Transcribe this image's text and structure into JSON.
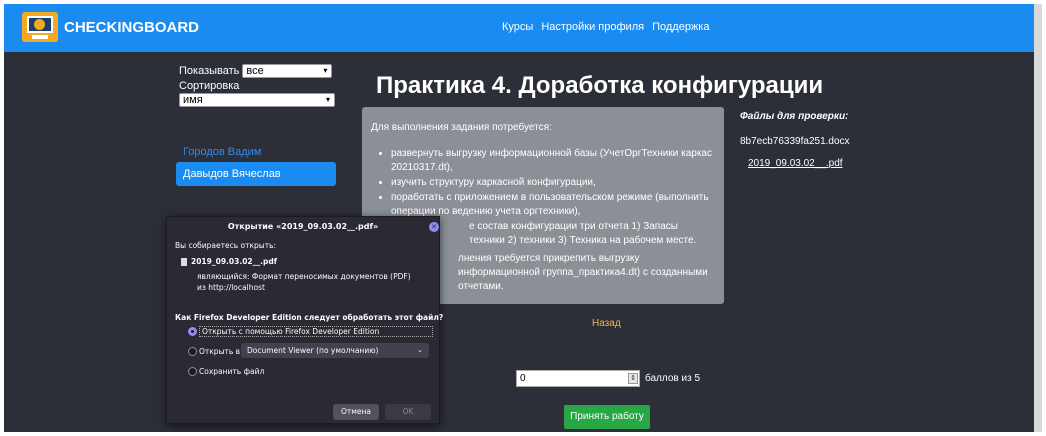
{
  "header": {
    "brand": "CHECKINGBOARD",
    "nav": [
      "Курсы",
      "Настройки профиля",
      "Поддержка"
    ],
    "bg_color": "#1a8cf1"
  },
  "filters": {
    "show_label": "Показывать",
    "show_value": "все",
    "sort_label": "Сортировка",
    "sort_value": "имя"
  },
  "students": [
    {
      "name": "Городов Вадим",
      "selected": false
    },
    {
      "name": "Давыдов Вячеслав",
      "selected": true
    }
  ],
  "page_title": "Практика 4. Доработка конфигурации",
  "task": {
    "intro": "Для выполнения задания потребуется:",
    "items": [
      "развернуть выгрузку информационной базы (УчетОргТехники каркас 20210317.dt),",
      "изучить структуру каркасной конфигурации,",
      "поработать с приложением в пользовательском режиме (выполнить операции по ведению учета оргтехники),",
      "е состав конфигурации три отчета 1) Запасы техники 2) техники 3) Техника на рабочем месте."
    ],
    "extra": "лнения требуется прикрепить выгрузку информационной группа_практика4.dt) с созданными отчетами."
  },
  "files": {
    "title": "Файлы для проверки:",
    "list": [
      "8b7ecb76339fa251.docx",
      "2019_09.03.02__.pdf"
    ]
  },
  "back_link": "Назад",
  "score": {
    "value": "0",
    "suffix": "баллов из 5"
  },
  "accept_button": "Принять работу",
  "dialog": {
    "title": "Открытие «2019_09.03.02__.pdf»",
    "intro": "Вы собираетесь открыть:",
    "filename": "2019_09.03.02__.pdf",
    "type_line": "являющийся: Формат переносимых документов (PDF)",
    "from_line": "из http://localhost",
    "question": "Как Firefox Developer Edition следует обработать этот файл?",
    "options": [
      {
        "label": "Открыть с помощью Firefox Developer Edition",
        "selected": true
      },
      {
        "label": "Открыть в",
        "selected": false
      },
      {
        "label": "Сохранить файл",
        "selected": false
      }
    ],
    "app_select": "Document Viewer (по умолчанию)",
    "cancel": "Отмена",
    "ok": "OK"
  }
}
